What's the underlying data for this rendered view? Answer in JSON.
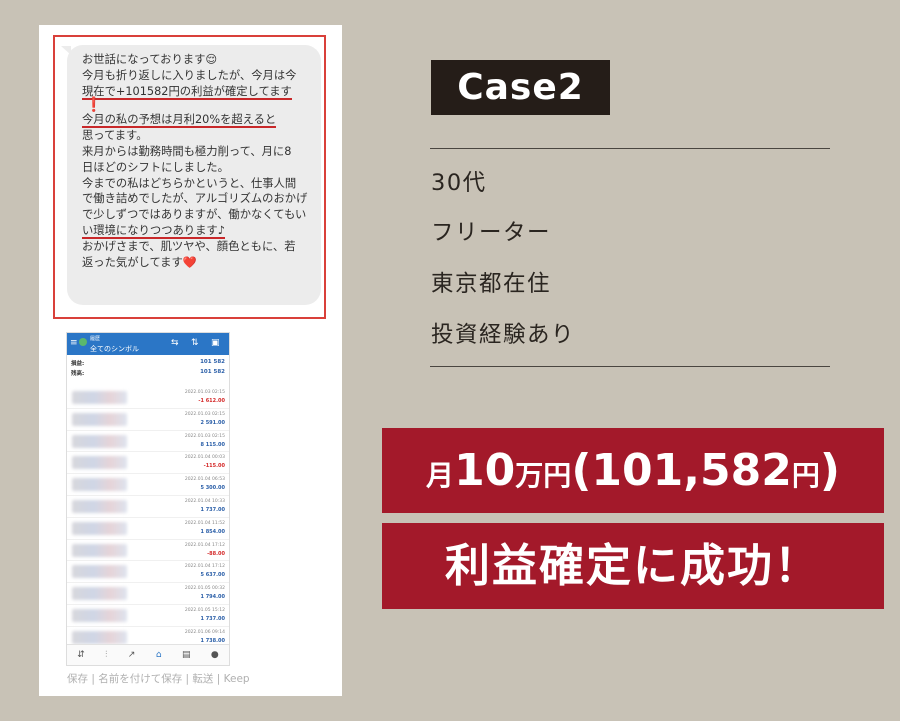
{
  "chat": {
    "lines": [
      "お世話になっております😌",
      "今月も折り返しに入りましたが、今月は今",
      "現在で+101582円の利益が確定してます",
      "❗",
      "今月の私の予想は月利20%を超えると",
      "思ってます。",
      "来月からは勤務時間も極力削って、月に8",
      "日ほどのシフトにしました。",
      "今までの私はどちらかというと、仕事人間",
      "で働き詰めでしたが、アルゴリズムのおかげ",
      "で少しずつではありますが、働かなくてもい",
      "い環境になりつつあります♪",
      "おかげさまで、肌ツヤや、顔色ともに、若",
      "返った気がしてます❤️"
    ]
  },
  "phone": {
    "header_small": "履歴",
    "header_title": "全てのシンボル",
    "summary": [
      {
        "label": "損益:",
        "value": "101 582"
      },
      {
        "label": "残高:",
        "value": "101 582"
      }
    ],
    "items": [
      {
        "date": "2022.01.03 02:15",
        "amount": "-1 612.00",
        "sign": "neg"
      },
      {
        "date": "2022.01.03 02:15",
        "amount": "2 591.00",
        "sign": "pos"
      },
      {
        "date": "2022.01.03 02:15",
        "amount": "8 115.00",
        "sign": "pos"
      },
      {
        "date": "2022.01.04 00:03",
        "amount": "-115.00",
        "sign": "neg"
      },
      {
        "date": "2022.01.04 06:53",
        "amount": "5 300.00",
        "sign": "pos"
      },
      {
        "date": "2022.01.04 10:33",
        "amount": "1 737.00",
        "sign": "pos"
      },
      {
        "date": "2022.01.04 11:52",
        "amount": "1 854.00",
        "sign": "pos"
      },
      {
        "date": "2022.01.04 17:12",
        "amount": "-88.00",
        "sign": "neg"
      },
      {
        "date": "2022.01.04 17:12",
        "amount": "5 637.00",
        "sign": "pos"
      },
      {
        "date": "2022.01.05 00:32",
        "amount": "1 794.00",
        "sign": "pos"
      },
      {
        "date": "2022.01.05 15:12",
        "amount": "1 737.00",
        "sign": "pos"
      },
      {
        "date": "2022.01.06 09:14",
        "amount": "1 738.00",
        "sign": "pos"
      },
      {
        "date": "2022.01.06 21:55",
        "amount": "",
        "sign": "pos"
      }
    ]
  },
  "caption": "保存 | 名前を付けて保存 | 転送 | Keep",
  "case_label": "Case2",
  "profile": [
    "30代",
    "フリーター",
    "東京都在住",
    "投資経験あり"
  ],
  "banner1": {
    "p1": "月",
    "p2": "10",
    "p3": "万円",
    "p4": "(101,582",
    "p5": "円",
    "p6": ")"
  },
  "banner2": "利益確定に成功！",
  "colors": {
    "background": "#c8c2b6",
    "banner": "#a3192a",
    "badge": "#251d18",
    "underline": "#c8282a"
  }
}
